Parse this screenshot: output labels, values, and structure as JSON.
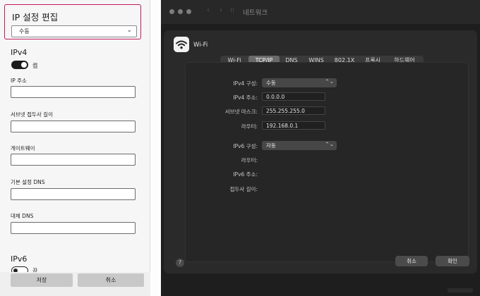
{
  "windows_panel": {
    "title": "IP 설정 편집",
    "mode_value": "수동",
    "ipv4_section": "IPv4",
    "ipv4_toggle_label": "켬",
    "ipv4_toggle_on": true,
    "fields": [
      {
        "label": "IP 주소",
        "value": ""
      },
      {
        "label": "서브넷 접두사 길이",
        "value": ""
      },
      {
        "label": "게이트웨이",
        "value": ""
      },
      {
        "label": "기본 설정 DNS",
        "value": ""
      },
      {
        "label": "대체 DNS",
        "value": ""
      }
    ],
    "ipv6_section": "IPv6",
    "ipv6_toggle_label": "끔",
    "ipv6_toggle_on": false,
    "save_label": "저장",
    "cancel_label": "취소",
    "accent": "#c2185b"
  },
  "mac_dialog": {
    "window_title": "네트워크",
    "interface_name": "Wi-Fi",
    "tabs": [
      "Wi-Fi",
      "TCP/IP",
      "DNS",
      "WINS",
      "802.1X",
      "프록시",
      "하드웨어"
    ],
    "active_tab": "TCP/IP",
    "ipv4_config_label": "IPv4 구성:",
    "ipv4_config_value": "수동",
    "ipv4_address_label": "IPv4 주소:",
    "ipv4_address_value": "0.0.0.0",
    "subnet_mask_label": "서브넷 마스크:",
    "subnet_mask_value": "255.255.255.0",
    "router_label": "라우터:",
    "router_value": "192.168.0.1",
    "ipv6_config_label": "IPv6 구성:",
    "ipv6_config_value": "자동",
    "ipv6_router_label": "라우터:",
    "ipv6_address_label": "IPv6 주소:",
    "prefix_length_label": "접두사 길이:",
    "help_label": "?",
    "cancel_label": "취소",
    "ok_label": "확인"
  }
}
